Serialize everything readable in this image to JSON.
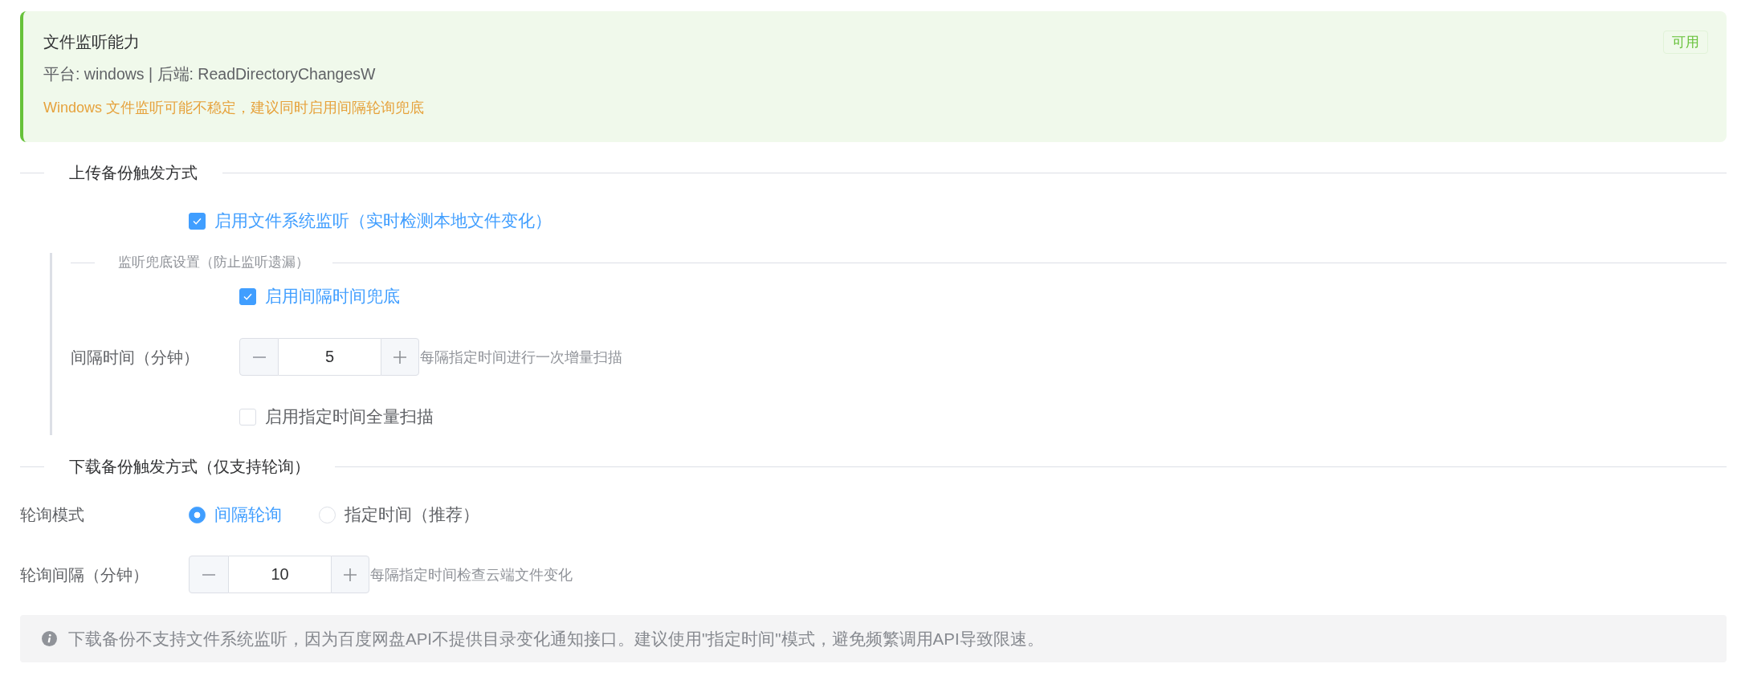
{
  "capability_card": {
    "title": "文件监听能力",
    "badge": "可用",
    "details": "平台: windows | 后端: ReadDirectoryChangesW",
    "warning": "Windows 文件监听可能不稳定，建议同时启用间隔轮询兜底"
  },
  "upload_section": {
    "heading": "上传备份触发方式",
    "watch_option": {
      "label": "启用文件系统监听（实时检测本地文件变化）",
      "checked": true
    },
    "fallback": {
      "heading": "监听兜底设置（防止监听遗漏）",
      "interval_option": {
        "label": "启用间隔时间兜底",
        "checked": true
      },
      "interval": {
        "label": "间隔时间（分钟）",
        "value": "5",
        "hint": "每隔指定时间进行一次增量扫描"
      },
      "full_scan_option": {
        "label": "启用指定时间全量扫描",
        "checked": false
      }
    }
  },
  "download_section": {
    "heading": "下载备份触发方式（仅支持轮询）",
    "mode": {
      "label": "轮询模式",
      "options": [
        {
          "label": "间隔轮询",
          "selected": true
        },
        {
          "label": "指定时间（推荐）",
          "selected": false
        }
      ]
    },
    "interval": {
      "label": "轮询间隔（分钟）",
      "value": "10",
      "hint": "每隔指定时间检查云端文件变化"
    }
  },
  "info_note": "下载备份不支持文件系统监听，因为百度网盘API不提供目录变化通知接口。建议使用\"指定时间\"模式，避免频繁调用API导致限速。"
}
